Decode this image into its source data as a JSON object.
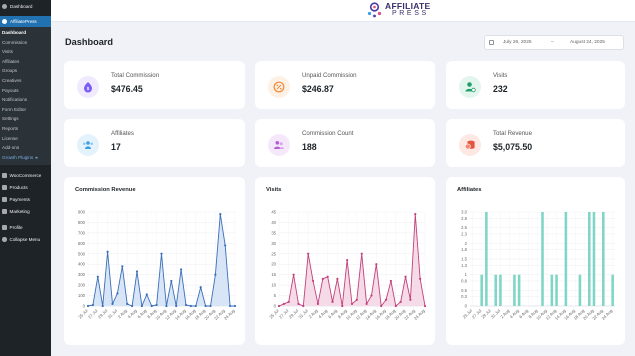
{
  "sidebar": {
    "dashboard": "Dashboard",
    "plugin": "AffiliatePress",
    "submenu": [
      "Dashboard",
      "Commission",
      "Visits",
      "Affiliates",
      "Groups",
      "Creatives",
      "Payouts",
      "Notifications",
      "Form Editor",
      "Settings",
      "Reports",
      "License",
      "Add-ons"
    ],
    "growth": "Growth Plugins",
    "menu": [
      "WooCommerce",
      "Products",
      "Payments",
      "Marketing",
      "Profile",
      "Collapse Menu"
    ]
  },
  "brand": {
    "line1": "AFFILIATE",
    "line2": "PRESS"
  },
  "page": {
    "title": "Dashboard"
  },
  "daterange": {
    "start": "July 26, 2025",
    "separator": "–",
    "end": "August 24, 2025"
  },
  "stats": [
    {
      "label": "Total Commission",
      "value": "$476.45",
      "icon": "dollar-tag-icon",
      "color": "#7b5cf6",
      "bg": "#efeafe"
    },
    {
      "label": "Unpaid Commission",
      "value": "$246.87",
      "icon": "percent-badge-icon",
      "color": "#f0883a",
      "bg": "#fdf0e4"
    },
    {
      "label": "Visits",
      "value": "232",
      "icon": "user-visit-icon",
      "color": "#22a06b",
      "bg": "#e3f6ee"
    },
    {
      "label": "Affiliates",
      "value": "17",
      "icon": "affiliates-group-icon",
      "color": "#3b9ee0",
      "bg": "#e4f2fc"
    },
    {
      "label": "Commission Count",
      "value": "188",
      "icon": "users-count-icon",
      "color": "#b45fd6",
      "bg": "#f5e8fb"
    },
    {
      "label": "Total Revenue",
      "value": "$5,075.50",
      "icon": "revenue-coins-icon",
      "color": "#e4553f",
      "bg": "#fde8e4"
    }
  ],
  "chart_data": [
    {
      "type": "area",
      "title": "Commission Revenue",
      "color": "#3a6fb8",
      "fill": "#d8e5f6",
      "ylim": [
        0,
        900
      ],
      "yticks": [
        0,
        100,
        200,
        300,
        400,
        500,
        600,
        700,
        800,
        900
      ],
      "x": [
        "25 Jul",
        "",
        "27 Jul",
        "",
        "29 Jul",
        "",
        "31 Jul",
        "",
        "2 Aug",
        "",
        "4 Aug",
        "",
        "6 Aug",
        "",
        "8 Aug",
        "",
        "10 Aug",
        "",
        "12 Aug",
        "",
        "14 Aug",
        "",
        "16 Aug",
        "",
        "18 Aug",
        "",
        "20 Aug",
        "",
        "22 Aug",
        "",
        "24 Aug"
      ],
      "xticks": [
        "25 Jul",
        "27 Jul",
        "29 Jul",
        "31 Jul",
        "2 Aug",
        "4 Aug",
        "6 Aug",
        "8 Aug",
        "10 Aug",
        "12 Aug",
        "14 Aug",
        "16 Aug",
        "18 Aug",
        "20 Aug",
        "22 Aug",
        "24 Aug"
      ],
      "values": [
        0,
        10,
        280,
        0,
        520,
        20,
        120,
        380,
        20,
        0,
        330,
        0,
        110,
        0,
        10,
        500,
        0,
        240,
        0,
        350,
        10,
        0,
        0,
        180,
        0,
        0,
        300,
        880,
        580,
        0,
        0
      ]
    },
    {
      "type": "area",
      "title": "Visits",
      "color": "#c2407c",
      "fill": "#f4dbe7",
      "ylim": [
        0,
        45
      ],
      "yticks": [
        0,
        5,
        10,
        15,
        20,
        25,
        30,
        35,
        40,
        45
      ],
      "x": [
        "25 Jul",
        "",
        "27 Jul",
        "",
        "29 Jul",
        "",
        "31 Jul",
        "",
        "2 Aug",
        "",
        "4 Aug",
        "",
        "6 Aug",
        "",
        "8 Aug",
        "",
        "10 Aug",
        "",
        "12 Aug",
        "",
        "14 Aug",
        "",
        "16 Aug",
        "",
        "18 Aug",
        "",
        "20 Aug",
        "",
        "22 Aug",
        "",
        "24 Aug"
      ],
      "xticks": [
        "25 Jul",
        "27 Jul",
        "29 Jul",
        "31 Jul",
        "2 Aug",
        "4 Aug",
        "6 Aug",
        "8 Aug",
        "10 Aug",
        "12 Aug",
        "14 Aug",
        "16 Aug",
        "18 Aug",
        "20 Aug",
        "22 Aug",
        "24 Aug"
      ],
      "values": [
        0,
        1,
        2,
        15,
        1,
        0,
        25,
        12,
        1,
        13,
        14,
        2,
        13,
        0,
        22,
        1,
        3,
        25,
        1,
        5,
        20,
        0,
        3,
        12,
        0,
        2,
        14,
        3,
        44,
        13,
        0
      ]
    },
    {
      "type": "bar",
      "title": "Affiliates",
      "color": "#7fd6c6",
      "ylim": [
        0,
        3
      ],
      "yticks": [
        0,
        0.3,
        0.5,
        0.8,
        1,
        1.3,
        1.5,
        1.8,
        2,
        2.3,
        2.5,
        2.8,
        3.0
      ],
      "ytick_labels": [
        "0",
        "0.3",
        "0.5",
        "0.8",
        "1",
        "1.3",
        "1.5",
        "1.8",
        "2",
        "2.3",
        "2.5",
        "2.8",
        "3.0"
      ],
      "x": [
        "25 Jul",
        "",
        "27 Jul",
        "",
        "29 Jul",
        "",
        "31 Jul",
        "",
        "2 Aug",
        "",
        "4 Aug",
        "",
        "6 Aug",
        "",
        "8 Aug",
        "",
        "10 Aug",
        "",
        "12 Aug",
        "",
        "14 Aug",
        "",
        "16 Aug",
        "",
        "18 Aug",
        "",
        "20 Aug",
        "",
        "22 Aug",
        "",
        "24 Aug"
      ],
      "xticks": [
        "25 Jul",
        "27 Jul",
        "29 Jul",
        "31 Jul",
        "2 Aug",
        "4 Aug",
        "6 Aug",
        "8 Aug",
        "10 Aug",
        "12 Aug",
        "14 Aug",
        "16 Aug",
        "18 Aug",
        "20 Aug",
        "22 Aug",
        "24 Aug"
      ],
      "values": [
        0,
        0,
        1,
        3,
        0,
        1,
        1,
        0,
        0,
        1,
        1,
        0,
        0,
        0,
        0,
        3,
        0,
        1,
        1,
        0,
        3,
        0,
        0,
        1,
        0,
        3,
        3,
        0,
        3,
        0,
        1
      ]
    }
  ]
}
